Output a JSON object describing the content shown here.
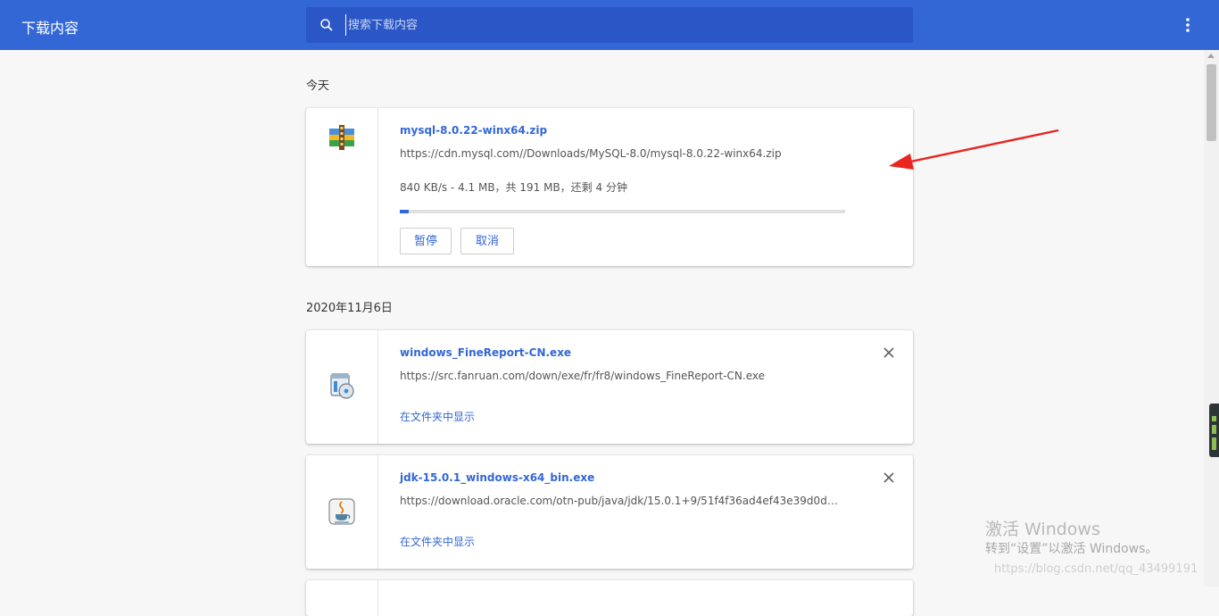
{
  "header": {
    "title": "下载内容",
    "search_placeholder": "搜索下载内容"
  },
  "groups": [
    {
      "date": "今天",
      "items": [
        {
          "file_name": "mysql-8.0.22-winx64.zip",
          "url": "https://cdn.mysql.com//Downloads/MySQL-8.0/mysql-8.0.22-winx64.zip",
          "status": "840 KB/s - 4.1 MB，共 191 MB，还剩 4 分钟",
          "progress": 0.021,
          "pause_label": "暂停",
          "cancel_label": "取消",
          "icon": "winrar-archive-icon"
        }
      ]
    },
    {
      "date": "2020年11月6日",
      "items": [
        {
          "file_name": "windows_FineReport-CN.exe",
          "url": "https://src.fanruan.com/down/exe/fr/fr8/windows_FineReport-CN.exe",
          "show_in_folder": "在文件夹中显示",
          "icon": "installer-disc-icon"
        },
        {
          "file_name": "jdk-15.0.1_windows-x64_bin.exe",
          "url": "https://download.oracle.com/otn-pub/java/jdk/15.0.1+9/51f4f36ad4ef43e39d0dfdb…",
          "show_in_folder": "在文件夹中显示",
          "icon": "java-cup-icon"
        }
      ]
    }
  ],
  "watermark": {
    "line1": "激活 Windows",
    "line2": "转到“设置”以激活 Windows。",
    "line3": "https://blog.csdn.net/qq_43499191"
  },
  "colors": {
    "header": "#3367d6",
    "search_bg": "#2a56c6",
    "link": "#3367d6",
    "annotation_arrow": "#e8251f"
  }
}
